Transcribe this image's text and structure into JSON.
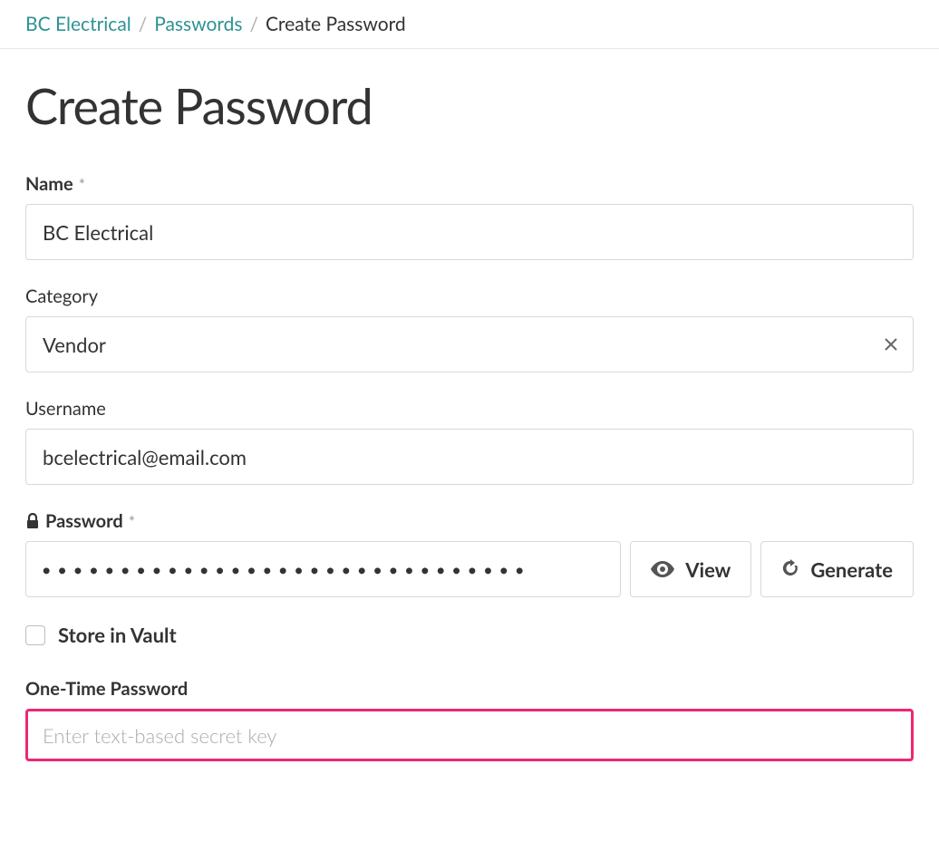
{
  "breadcrumb": {
    "items": [
      {
        "label": "BC Electrical",
        "link": true
      },
      {
        "label": "Passwords",
        "link": true
      },
      {
        "label": "Create Password",
        "link": false
      }
    ]
  },
  "page": {
    "title": "Create Password"
  },
  "form": {
    "name": {
      "label": "Name",
      "required_mark": "*",
      "value": "BC Electrical"
    },
    "category": {
      "label": "Category",
      "value": "Vendor"
    },
    "username": {
      "label": "Username",
      "value": "bcelectrical@email.com"
    },
    "password": {
      "label": "Password",
      "required_mark": "*",
      "masked_value": "●●●●●●●●●●●●●●●●●●●●●●●●●●●●●●●",
      "buttons": {
        "view": "View",
        "generate": "Generate"
      }
    },
    "store_in_vault": {
      "label": "Store in Vault",
      "checked": false
    },
    "otp": {
      "label": "One-Time Password",
      "placeholder": "Enter text-based secret key",
      "value": ""
    }
  }
}
